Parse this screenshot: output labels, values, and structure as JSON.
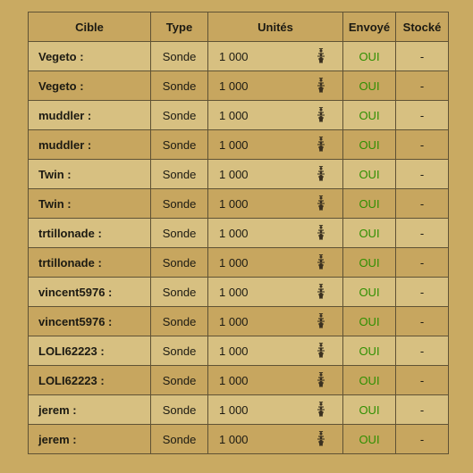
{
  "headers": {
    "cible": "Cible",
    "type": "Type",
    "unites": "Unités",
    "envoye": "Envoyé",
    "stocke": "Stocké"
  },
  "rows": [
    {
      "cible": "Vegeto :",
      "type": "Sonde",
      "unites": "1 000",
      "envoye": "OUI",
      "stocke": "-"
    },
    {
      "cible": "Vegeto :",
      "type": "Sonde",
      "unites": "1 000",
      "envoye": "OUI",
      "stocke": "-"
    },
    {
      "cible": "muddler :",
      "type": "Sonde",
      "unites": "1 000",
      "envoye": "OUI",
      "stocke": "-"
    },
    {
      "cible": "muddler :",
      "type": "Sonde",
      "unites": "1 000",
      "envoye": "OUI",
      "stocke": "-"
    },
    {
      "cible": "Twin :",
      "type": "Sonde",
      "unites": "1 000",
      "envoye": "OUI",
      "stocke": "-"
    },
    {
      "cible": "Twin :",
      "type": "Sonde",
      "unites": "1 000",
      "envoye": "OUI",
      "stocke": "-"
    },
    {
      "cible": "trtillonade :",
      "type": "Sonde",
      "unites": "1 000",
      "envoye": "OUI",
      "stocke": "-"
    },
    {
      "cible": "trtillonade :",
      "type": "Sonde",
      "unites": "1 000",
      "envoye": "OUI",
      "stocke": "-"
    },
    {
      "cible": "vincent5976 :",
      "type": "Sonde",
      "unites": "1 000",
      "envoye": "OUI",
      "stocke": "-"
    },
    {
      "cible": "vincent5976 :",
      "type": "Sonde",
      "unites": "1 000",
      "envoye": "OUI",
      "stocke": "-"
    },
    {
      "cible": "LOLI62223 :",
      "type": "Sonde",
      "unites": "1 000",
      "envoye": "OUI",
      "stocke": "-"
    },
    {
      "cible": "LOLI62223 :",
      "type": "Sonde",
      "unites": "1 000",
      "envoye": "OUI",
      "stocke": "-"
    },
    {
      "cible": "jerem :",
      "type": "Sonde",
      "unites": "1 000",
      "envoye": "OUI",
      "stocke": "-"
    },
    {
      "cible": "jerem :",
      "type": "Sonde",
      "unites": "1 000",
      "envoye": "OUI",
      "stocke": "-"
    }
  ],
  "unit_icon": "ant-icon",
  "colors": {
    "background": "#c9aa62",
    "row_light": "#d7c081",
    "row_dark": "#c7a65f",
    "ok_text": "#2e8f00",
    "border": "#5f5234"
  }
}
